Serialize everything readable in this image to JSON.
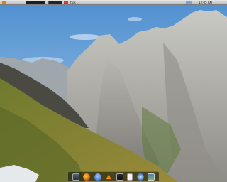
{
  "top_panel": {
    "window_label": "ttos ...",
    "clock": "12:05 AM"
  },
  "dock": {
    "items": [
      {
        "name": "monitor-icon"
      },
      {
        "name": "firefox-icon"
      },
      {
        "name": "drop-icon"
      },
      {
        "name": "vlc-icon"
      },
      {
        "name": "screen-icon"
      },
      {
        "name": "file-icon"
      },
      {
        "name": "eye-icon"
      },
      {
        "name": "photo-icon"
      }
    ]
  },
  "colors": {
    "sky": "#6aa4d8",
    "panel": "#d4d4d4",
    "dock": "#1a1a1a"
  }
}
